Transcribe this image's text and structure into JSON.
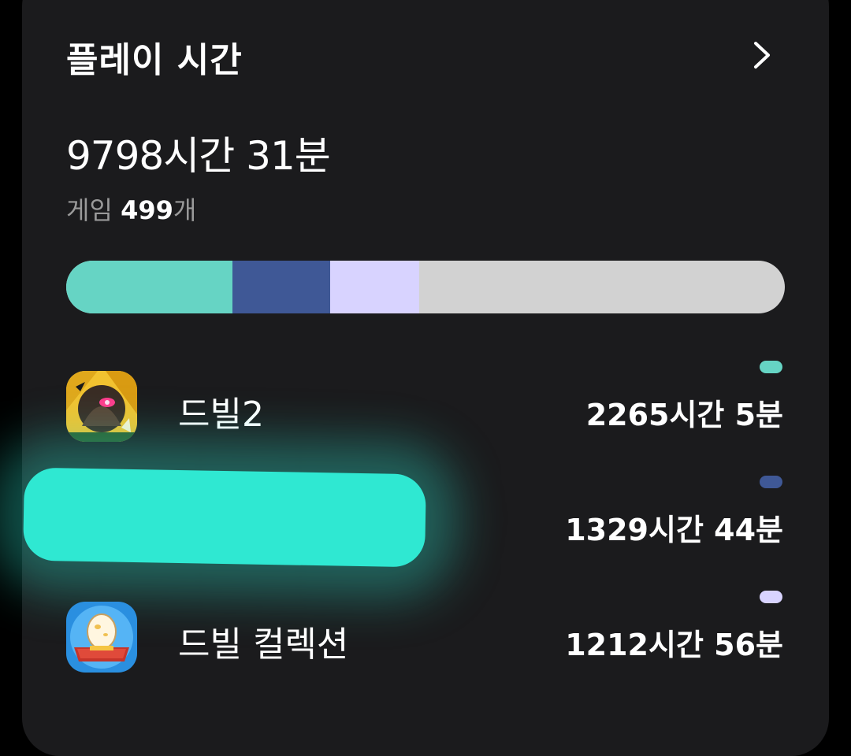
{
  "card": {
    "title": "플레이 시간",
    "total_time": "9798시간 31분",
    "games_label": "게임",
    "games_count": "499",
    "games_suffix": "개"
  },
  "usage_bar": {
    "segments": [
      {
        "color": "#66d4c4",
        "fraction": 0.231
      },
      {
        "color": "#3f5896",
        "fraction": 0.136
      },
      {
        "color": "#d8d3ff",
        "fraction": 0.124
      }
    ],
    "remainder_color": "#d2d2d2"
  },
  "games": [
    {
      "name": "드빌2",
      "time": "2265시간 5분",
      "color": "#66d4c4",
      "icon": "dark-warrior-game-icon"
    },
    {
      "name": "",
      "time": "1329시간 44분",
      "color": "#3f5896",
      "icon": ""
    },
    {
      "name": "드빌 컬렉션",
      "time": "1212시간 56분",
      "color": "#d8d3ff",
      "icon": "egg-anniversary-game-icon"
    }
  ],
  "icons": {
    "more": "chevron-right-icon"
  }
}
